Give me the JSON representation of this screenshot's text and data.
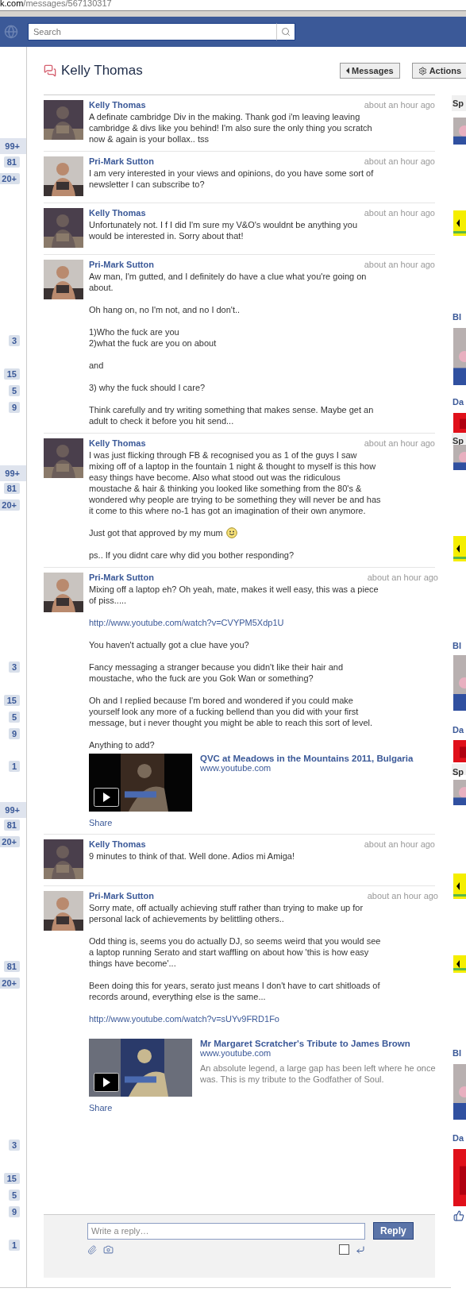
{
  "address_bar": {
    "host": "k.com",
    "path": "/messages/567130317"
  },
  "search": {
    "placeholder": "Search"
  },
  "left_badges": [
    {
      "label": "99+",
      "selected": true
    },
    {
      "label": "81",
      "selected": false
    },
    {
      "label": "20+",
      "selected": false
    },
    {
      "label": "3",
      "selected": false
    },
    {
      "label": "15",
      "selected": false
    },
    {
      "label": "5",
      "selected": false
    },
    {
      "label": "9",
      "selected": false
    },
    {
      "label": "99+",
      "selected": true
    },
    {
      "label": "81",
      "selected": false
    },
    {
      "label": "20+",
      "selected": false
    },
    {
      "label": "3",
      "selected": false
    },
    {
      "label": "15",
      "selected": false
    },
    {
      "label": "5",
      "selected": false
    },
    {
      "label": "9",
      "selected": false
    },
    {
      "label": "1",
      "selected": false
    },
    {
      "label": "99+",
      "selected": true
    },
    {
      "label": "81",
      "selected": false
    },
    {
      "label": "20+",
      "selected": false
    },
    {
      "label": "81",
      "selected": false
    },
    {
      "label": "20+",
      "selected": false
    },
    {
      "label": "3",
      "selected": false
    },
    {
      "label": "15",
      "selected": false
    },
    {
      "label": "5",
      "selected": false
    },
    {
      "label": "9",
      "selected": false
    },
    {
      "label": "1",
      "selected": false
    }
  ],
  "conversation": {
    "title": "Kelly Thomas",
    "buttons": [
      {
        "kind": "back",
        "label": "Messages"
      },
      {
        "kind": "gear",
        "label": "Actions"
      }
    ]
  },
  "messages": [
    {
      "sender": "Kelly Thomas",
      "time": "about an hour ago",
      "body": [
        {
          "kind": "text",
          "text": "A definate cambridge Div in the making. Thank god i'm leaving leaving cambridge & divs like you behind! I'm also sure the only thing you scratch now & again is your bollax.. tss"
        }
      ]
    },
    {
      "sender": "Pri-Mark Sutton",
      "time": "about an hour ago",
      "body": [
        {
          "kind": "text",
          "text": "I am very interested in your views and opinions, do you have some sort of newsletter I can subscribe to?"
        }
      ]
    },
    {
      "sender": "Kelly Thomas",
      "time": "about an hour ago",
      "body": [
        {
          "kind": "text",
          "text": "Unfortunately not. I f I did I'm sure my V&O's wouldnt be anything you would be interested in. Sorry about that!"
        }
      ]
    },
    {
      "sender": "Pri-Mark Sutton",
      "time": "about an hour ago",
      "body": [
        {
          "kind": "text",
          "text": "Aw man, I'm gutted, and I definitely do have a clue what you're going on about."
        },
        {
          "kind": "text",
          "text": "Oh hang on, no I'm not, and no I don't.."
        },
        {
          "kind": "text",
          "text": "1)Who the fuck are you\n2)what the fuck are you on about"
        },
        {
          "kind": "text",
          "text": "and"
        },
        {
          "kind": "text",
          "text": "3) why the fuck should I care?"
        },
        {
          "kind": "text",
          "text": "Think carefully and try writing something that makes sense. Maybe get an adult to check it before you hit send..."
        }
      ]
    },
    {
      "sender": "Kelly Thomas",
      "time": "about an hour ago",
      "body": [
        {
          "kind": "text",
          "text": "I was just flicking through FB & recognised you as 1 of the guys I saw mixing off of a laptop in the fountain 1 night & thought to myself is this how easy things have become. Also what stood out was the ridiculous moustache & hair & thinking you looked like something from the 80's & wondered why people are trying to be something they will never be and has it come to this where no-1 has got an imagination of their own anymore."
        },
        {
          "kind": "text",
          "text": "Just got that approved by my mum",
          "smiley": true
        },
        {
          "kind": "text",
          "text": "ps.. If you didnt care why did you bother responding?"
        }
      ]
    },
    {
      "sender": "Pri-Mark Sutton",
      "time": "about an hour ago",
      "body": [
        {
          "kind": "text",
          "text": "Mixing off a laptop eh? Oh yeah, mate, makes it well easy, this was a piece of piss....."
        },
        {
          "kind": "link",
          "text": "http://www.youtube.com/watch?v=CVYPM5Xdp1U"
        },
        {
          "kind": "text",
          "text": "You haven't actually got a clue have you?"
        },
        {
          "kind": "text",
          "text": "Fancy messaging a stranger because you didn't like their hair and moustache, who the fuck are you Gok Wan or something?"
        },
        {
          "kind": "text",
          "text": "Oh and I replied because I'm bored and wondered if you could make yourself look any more of a fucking bellend than you did with your first message, but i never thought you might be able to reach this sort of level."
        },
        {
          "kind": "text",
          "text": "Anything to add?"
        }
      ],
      "attachment": {
        "kind": "video",
        "title": "QVC at Meadows in the Mountains 2011, Bulgaria",
        "source": "www.youtube.com",
        "share": "Share"
      }
    },
    {
      "sender": "Kelly Thomas",
      "time": "about an hour ago",
      "body": [
        {
          "kind": "text",
          "text": "9 minutes to think of that. Well done. Adios mi Amiga!"
        }
      ]
    },
    {
      "sender": "Pri-Mark Sutton",
      "time": "about an hour ago",
      "body": [
        {
          "kind": "text",
          "text": "Sorry mate, off actually achieving stuff rather than trying to make up for personal lack of achievements by belittling others.."
        },
        {
          "kind": "text",
          "text": "Odd thing is, seems you do actually DJ, so seems weird that you would see a laptop running Serato and start waffling on about how 'this is how easy things have become'..."
        },
        {
          "kind": "text",
          "text": "Been doing this for years, serato just means I don't have to cart shitloads of records around, everything else is the same..."
        },
        {
          "kind": "link",
          "text": "http://www.youtube.com/watch?v=sUYv9FRD1Fo"
        }
      ],
      "attachment": {
        "kind": "video",
        "title": "Mr Margaret Scratcher's Tribute to James Brown",
        "source": "www.youtube.com",
        "description": "An absolute legend, a large gap has been left where he once was. This is my tribute to the Godfather of Soul.",
        "share": "Share"
      }
    }
  ],
  "reply": {
    "placeholder": "Write a reply…",
    "button": "Reply",
    "enter_to_send": false
  },
  "right_column": [
    {
      "kind": "header",
      "text": "Sp"
    },
    {
      "kind": "picture"
    },
    {
      "kind": "ad"
    },
    {
      "kind": "heading",
      "text": "BI"
    },
    {
      "kind": "picture"
    },
    {
      "kind": "heading",
      "text": "Da"
    },
    {
      "kind": "red"
    },
    {
      "kind": "header",
      "text": "Sp"
    },
    {
      "kind": "picture"
    },
    {
      "kind": "ad"
    },
    {
      "kind": "heading",
      "text": "BI"
    },
    {
      "kind": "picture"
    },
    {
      "kind": "heading",
      "text": "Da"
    },
    {
      "kind": "red"
    },
    {
      "kind": "header",
      "text": "Sp"
    },
    {
      "kind": "picture"
    },
    {
      "kind": "ad"
    },
    {
      "kind": "ad"
    },
    {
      "kind": "heading",
      "text": "BI"
    },
    {
      "kind": "picture"
    },
    {
      "kind": "heading",
      "text": "Da"
    },
    {
      "kind": "red"
    },
    {
      "kind": "like"
    }
  ]
}
